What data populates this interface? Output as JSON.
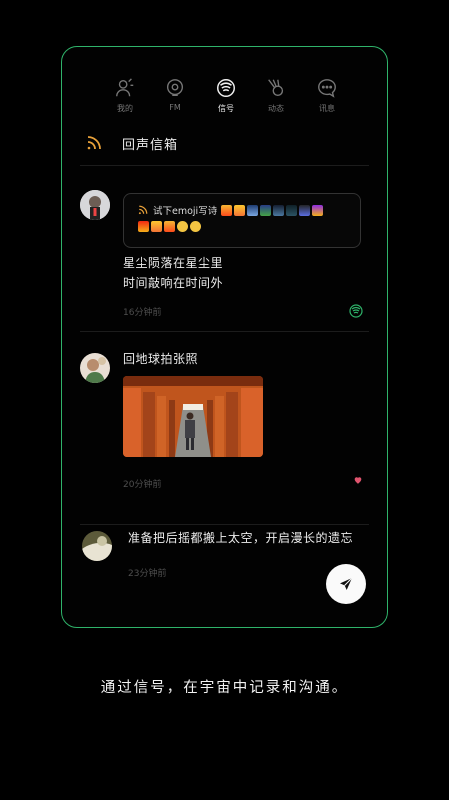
{
  "nav": {
    "items": [
      {
        "label": "我的",
        "icon": "profile-icon"
      },
      {
        "label": "FM",
        "icon": "fm-icon"
      },
      {
        "label": "信号",
        "icon": "signal-icon",
        "active": true
      },
      {
        "label": "动态",
        "icon": "comet-icon"
      },
      {
        "label": "讯息",
        "icon": "message-icon"
      }
    ]
  },
  "inbox": {
    "title": "回声信箱"
  },
  "posts": [
    {
      "quote": "试下emoji写诗",
      "text_line1": "星尘陨落在星尘里",
      "text_line2": "时间敲响在时间外",
      "time": "16分钟前"
    },
    {
      "text": "回地球拍张照",
      "time": "20分钟前"
    },
    {
      "text": "准备把后摇都搬上太空，开启漫长的遗忘",
      "time": "23分钟前"
    }
  ],
  "caption": "通过信号，在宇宙中记录和沟通。",
  "colors": {
    "accent": "#2fb36a",
    "like": "#e0546e",
    "rss": "#e8a13a"
  }
}
